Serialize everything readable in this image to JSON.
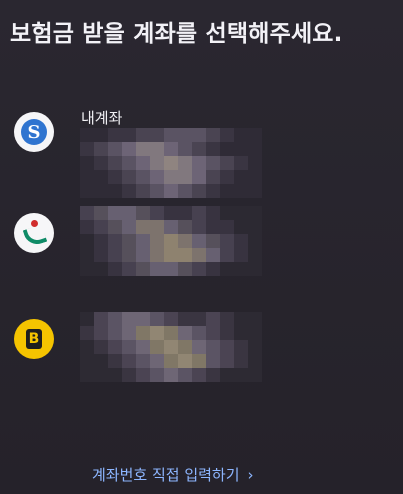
{
  "header": {
    "title": "보험금 받을 계좌를 선택해주세요."
  },
  "accounts": [
    {
      "label": "내계좌",
      "logo_icon": "bank-s-icon",
      "logo_color": "#2f74d0"
    },
    {
      "label": "",
      "logo_icon": "bank-leaf-icon",
      "logo_color": "#0f8b67"
    },
    {
      "label": "",
      "logo_icon": "bank-b-icon",
      "logo_color": "#f5c400"
    }
  ],
  "footer": {
    "direct_input_label": "계좌번호 직접 입력하기",
    "chevron": "›"
  }
}
